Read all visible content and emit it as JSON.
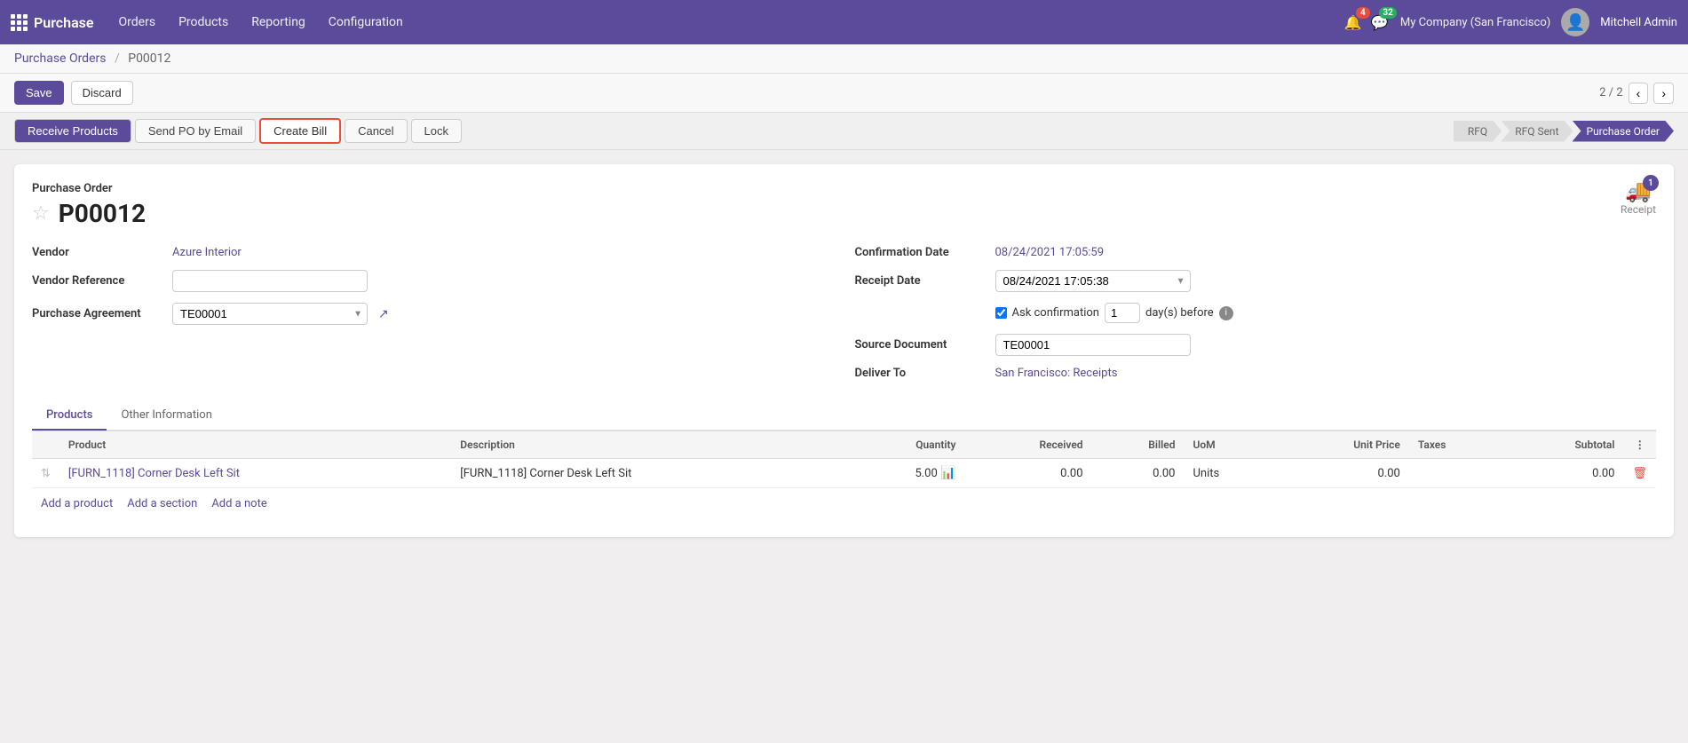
{
  "app": {
    "title": "Purchase",
    "nav_items": [
      "Orders",
      "Products",
      "Reporting",
      "Configuration"
    ]
  },
  "topbar": {
    "notification_count": "4",
    "chat_count": "32",
    "company": "My Company (San Francisco)",
    "user": "Mitchell Admin"
  },
  "breadcrumb": {
    "parent": "Purchase Orders",
    "current": "P00012",
    "separator": "/"
  },
  "actions": {
    "save": "Save",
    "discard": "Discard",
    "page_indicator": "2 / 2"
  },
  "toolbar": {
    "receive_products": "Receive Products",
    "send_po_email": "Send PO by Email",
    "create_bill": "Create Bill",
    "cancel": "Cancel",
    "lock": "Lock"
  },
  "status_steps": [
    {
      "label": "RFQ",
      "active": false
    },
    {
      "label": "RFQ Sent",
      "active": false
    },
    {
      "label": "Purchase Order",
      "active": true
    }
  ],
  "receipt_badge": {
    "count": "1",
    "label": "Receipt"
  },
  "document": {
    "type_label": "Purchase Order",
    "number": "P00012"
  },
  "form": {
    "left": {
      "vendor_label": "Vendor",
      "vendor_value": "Azure Interior",
      "vendor_ref_label": "Vendor Reference",
      "vendor_ref_value": "",
      "purchase_agreement_label": "Purchase Agreement",
      "purchase_agreement_value": "TE00001"
    },
    "right": {
      "confirmation_date_label": "Confirmation Date",
      "confirmation_date_value": "08/24/2021 17:05:59",
      "receipt_date_label": "Receipt Date",
      "receipt_date_value": "08/24/2021 17:05:38",
      "ask_confirmation_label": "Ask confirmation",
      "ask_confirmation_days": "1",
      "ask_confirmation_suffix": "day(s) before",
      "source_document_label": "Source Document",
      "source_document_value": "TE00001",
      "deliver_to_label": "Deliver To",
      "deliver_to_value": "San Francisco: Receipts"
    }
  },
  "tabs": [
    {
      "label": "Products",
      "active": true
    },
    {
      "label": "Other Information",
      "active": false
    }
  ],
  "table": {
    "columns": [
      {
        "label": ""
      },
      {
        "label": "Product"
      },
      {
        "label": "Description"
      },
      {
        "label": "Quantity"
      },
      {
        "label": "Received"
      },
      {
        "label": "Billed"
      },
      {
        "label": "UoM"
      },
      {
        "label": "Unit Price"
      },
      {
        "label": "Taxes"
      },
      {
        "label": "Subtotal"
      },
      {
        "label": "⋮"
      }
    ],
    "rows": [
      {
        "product": "[FURN_1118] Corner Desk Left Sit",
        "description": "[FURN_1118] Corner Desk Left Sit",
        "quantity": "5.00",
        "received": "0.00",
        "billed": "0.00",
        "uom": "Units",
        "unit_price": "0.00",
        "taxes": "",
        "subtotal": "0.00"
      }
    ],
    "add_product": "Add a product",
    "add_section": "Add a section",
    "add_note": "Add a note"
  }
}
